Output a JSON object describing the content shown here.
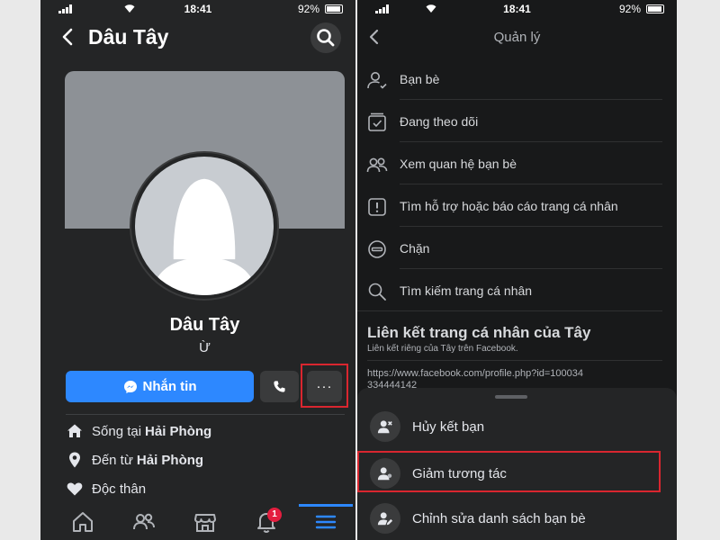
{
  "status_bar": {
    "time": "18:41",
    "battery": "92%",
    "battery_level": 0.92
  },
  "left": {
    "title": "Dâu Tây",
    "profile_name": "Dâu Tây",
    "nickname": "Ừ",
    "message_button": "Nhắn tin",
    "more_button": "···",
    "info": [
      {
        "prefix": "Sống tại",
        "value": "Hải Phòng",
        "icon": "home-icon"
      },
      {
        "prefix": "Đến từ",
        "value": "Hải Phòng",
        "icon": "location-pin-icon"
      },
      {
        "prefix": "Độc thân",
        "value": "",
        "icon": "heart-icon"
      }
    ],
    "notification_count": "1",
    "accent_color": "#2d88ff",
    "highlight_color": "#d9262f"
  },
  "right": {
    "title": "Quản lý",
    "menu": [
      {
        "label": "Bạn bè",
        "icon": "friend-check-icon"
      },
      {
        "label": "Đang theo dõi",
        "icon": "following-icon"
      },
      {
        "label": "Xem quan hệ bạn bè",
        "icon": "friendship-icon"
      },
      {
        "label": "Tìm hỗ trợ hoặc báo cáo trang cá nhân",
        "icon": "report-icon"
      },
      {
        "label": "Chặn",
        "icon": "block-icon"
      },
      {
        "label": "Tìm kiếm trang cá nhân",
        "icon": "search-icon"
      }
    ],
    "link_title": "Liên kết trang cá nhân của Tây",
    "link_subtitle": "Liên kết riêng của Tây trên Facebook.",
    "link_url": "https://www.facebook.com/profile.php?id=100034334444142",
    "sheet": [
      {
        "label": "Hủy kết bạn",
        "icon": "unfriend-icon"
      },
      {
        "label": "Giảm tương tác",
        "icon": "reduce-interaction-icon"
      },
      {
        "label": "Chỉnh sửa danh sách bạn bè",
        "icon": "edit-friend-list-icon"
      }
    ]
  }
}
